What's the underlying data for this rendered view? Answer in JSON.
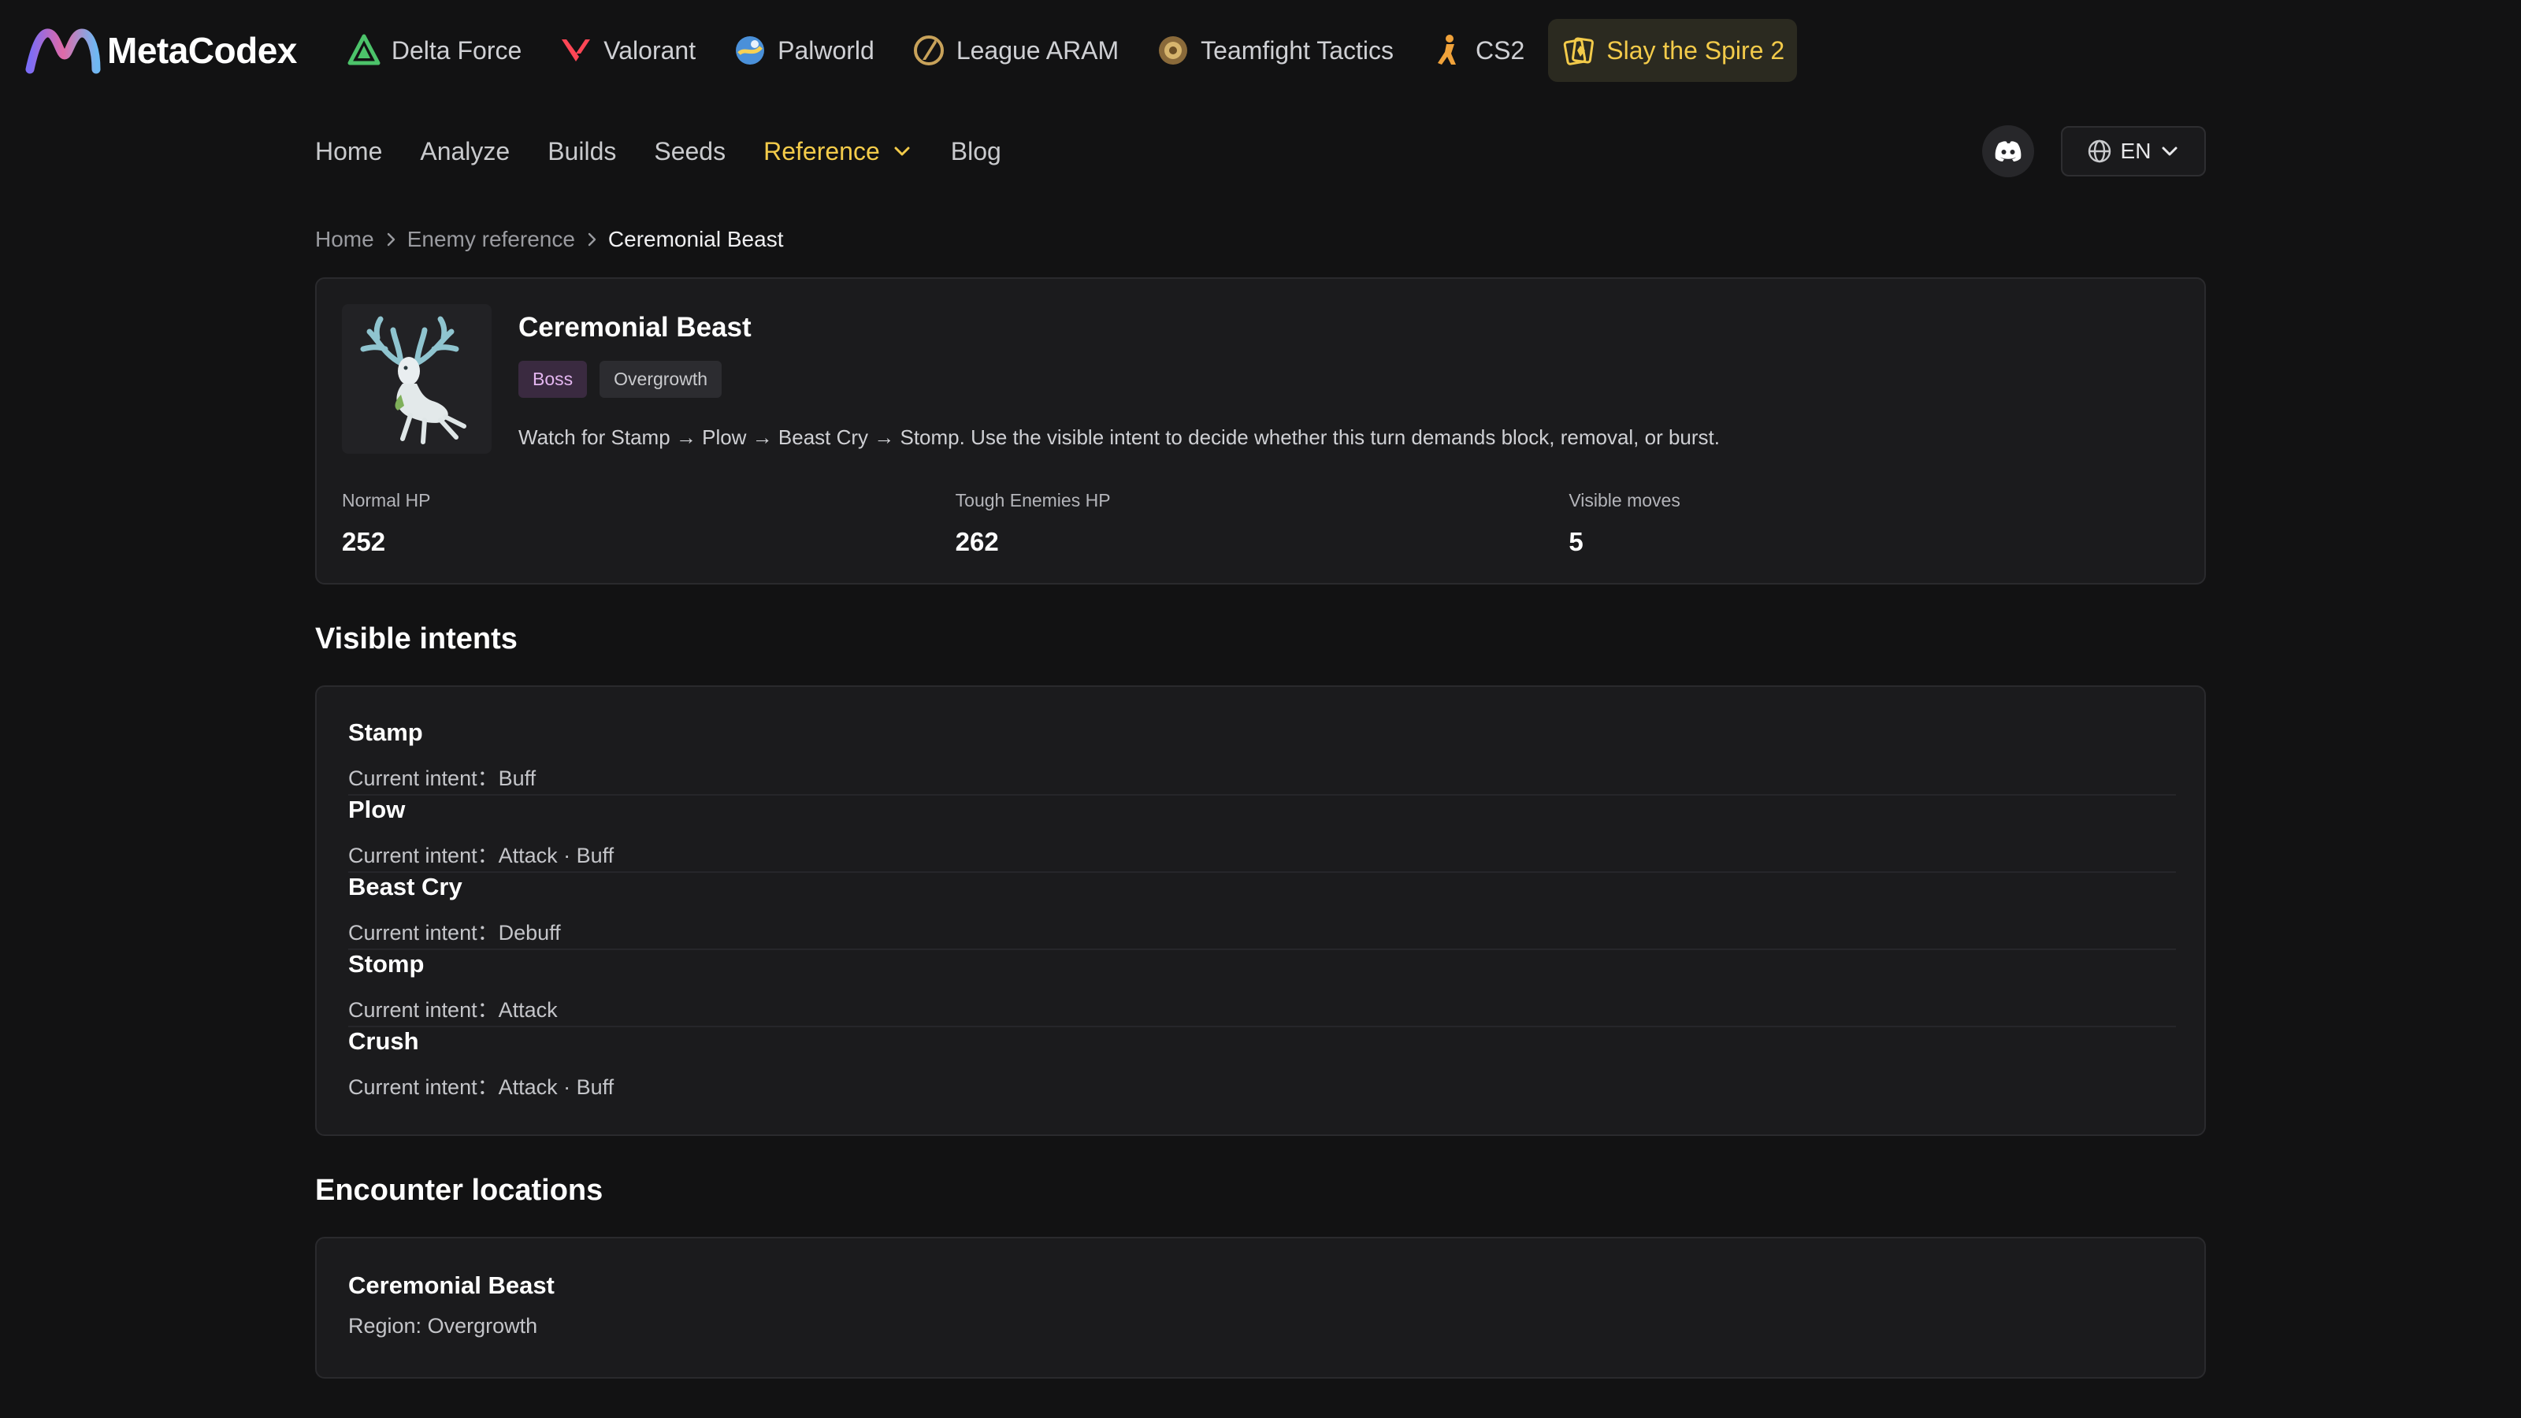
{
  "brand": {
    "name": "MetaCodex"
  },
  "games": [
    {
      "label": "Delta Force",
      "icon": "delta-force-icon"
    },
    {
      "label": "Valorant",
      "icon": "valorant-icon"
    },
    {
      "label": "Palworld",
      "icon": "palworld-icon"
    },
    {
      "label": "League ARAM",
      "icon": "league-icon"
    },
    {
      "label": "Teamfight Tactics",
      "icon": "tft-icon"
    },
    {
      "label": "CS2",
      "icon": "cs2-icon"
    },
    {
      "label": "Slay the Spire 2",
      "icon": "slay-the-spire-icon",
      "active": true
    }
  ],
  "nav": {
    "items": [
      "Home",
      "Analyze",
      "Builds",
      "Seeds",
      "Reference",
      "Blog"
    ],
    "active": "Reference",
    "lang": "EN"
  },
  "breadcrumb": [
    "Home",
    "Enemy reference",
    "Ceremonial Beast"
  ],
  "enemy": {
    "name": "Ceremonial Beast",
    "tags": [
      "Boss",
      "Overgrowth"
    ],
    "description": "Watch for Stamp → Plow → Beast Cry → Stomp. Use the visible intent to decide whether this turn demands block, removal, or burst.",
    "stats": [
      {
        "label": "Normal HP",
        "value": "252"
      },
      {
        "label": "Tough Enemies HP",
        "value": "262"
      },
      {
        "label": "Visible moves",
        "value": "5"
      }
    ]
  },
  "intents_section": {
    "title": "Visible intents",
    "prefix": "Current intent：",
    "items": [
      {
        "name": "Stamp",
        "intent": "Buff"
      },
      {
        "name": "Plow",
        "intent": "Attack · Buff"
      },
      {
        "name": "Beast Cry",
        "intent": "Debuff"
      },
      {
        "name": "Stomp",
        "intent": "Attack"
      },
      {
        "name": "Crush",
        "intent": "Attack · Buff"
      }
    ]
  },
  "locations_section": {
    "title": "Encounter locations",
    "items": [
      {
        "name": "Ceremonial Beast",
        "region": "Region: Overgrowth"
      }
    ]
  },
  "colors": {
    "background": "#121213",
    "accent": "#f3cb4a",
    "card": "#1b1b1d",
    "boss_tag": "#3a2a40"
  }
}
